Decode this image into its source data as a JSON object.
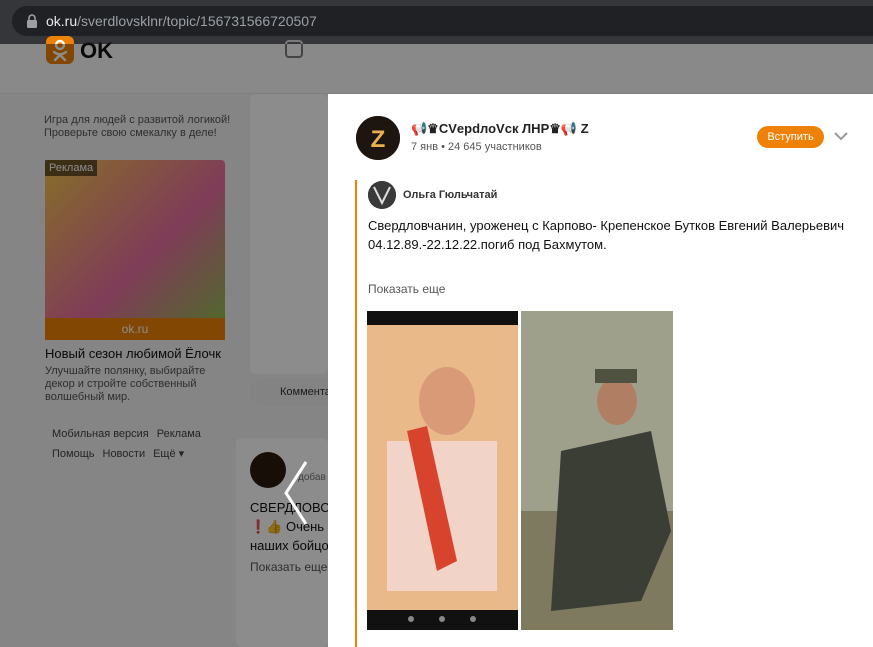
{
  "browser": {
    "url_host": "ok.ru",
    "url_path": "/sverdlovsklnr/topic/156731566720507"
  },
  "ok": {
    "logo_text": "OK"
  },
  "sidebar": {
    "promo_caption": "Игра для людей с развитой логикой! Проверьте свою смекалку в деле!",
    "ad_tag": "Реклама",
    "ad_bar": "ok.ru",
    "ad_title": "Новый сезон любимой Ёлочк",
    "ad_desc": "Улучшайте полянку, выбирайте декор и стройте собственный волшебный мир.",
    "footer": [
      "Мобильная версия",
      "Реклама",
      "Помощь",
      "Новости",
      "Ещё ▾"
    ]
  },
  "feed": {
    "comment_label": "Коммента",
    "title_fragment": "СВЕРДЛОВС",
    "line2": "❗👍 Очень",
    "line3": "наших бойцо",
    "show_more": "Показать еще",
    "meta": "добав"
  },
  "modal": {
    "group_name": "📢♛CVерdлоVск ЛНР♛📢 Z",
    "group_meta": "7 янв • 24 645 участников",
    "join_label": "Вступить",
    "author_name": "Ольга Гюльчатай",
    "post_text": "Свердловчанин, уроженец с Карпово- Крепенское Бутков Евгений Валерьевич 04.12.89.-22.12.22.погиб под Бахмутом.",
    "show_more": "Показать еще"
  },
  "colors": {
    "accent": "#ee8208"
  },
  "icons": [
    "lock-icon",
    "mail-icon",
    "chevron-down-icon",
    "chevron-left-icon"
  ]
}
